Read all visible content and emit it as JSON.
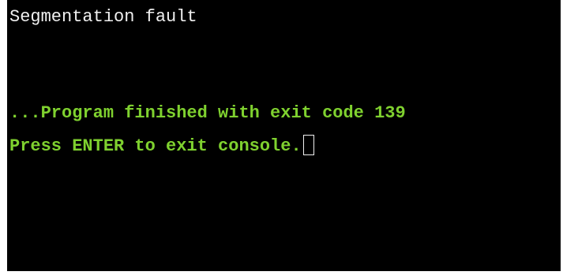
{
  "console": {
    "lines": [
      {
        "text": "Segmentation fault",
        "color": "#f0f0f0"
      },
      {
        "text": "...Program finished with exit code 139",
        "color": "#7fd12f"
      },
      {
        "text": "Press ENTER to exit console.",
        "color": "#7fd12f"
      }
    ],
    "cursor": "block-cursor"
  }
}
